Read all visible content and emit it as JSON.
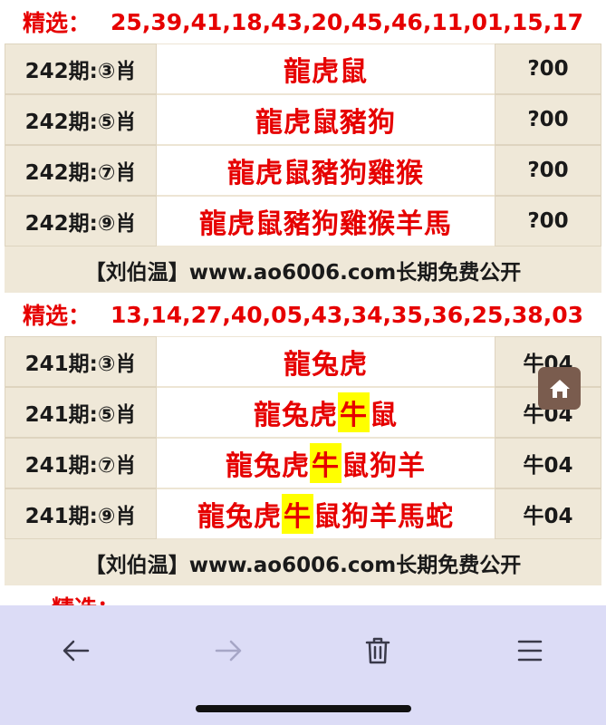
{
  "section1": {
    "pick_label": "精选：",
    "pick_numbers": "25,39,41,18,43,20,45,46,11,01,15,17",
    "rows": [
      {
        "period": "242期:③肖",
        "before": "龍虎鼠",
        "highlight": "",
        "after": "",
        "result": "?00"
      },
      {
        "period": "242期:⑤肖",
        "before": "龍虎鼠豬狗",
        "highlight": "",
        "after": "",
        "result": "?00"
      },
      {
        "period": "242期:⑦肖",
        "before": "龍虎鼠豬狗雞猴",
        "highlight": "",
        "after": "",
        "result": "?00"
      },
      {
        "period": "242期:⑨肖",
        "before": "龍虎鼠豬狗雞猴羊馬",
        "highlight": "",
        "after": "",
        "result": "?00"
      }
    ],
    "promo": "【刘伯温】www.ao6006.com长期免费公开"
  },
  "section2": {
    "pick_label": "精选：",
    "pick_numbers": "13,14,27,40,05,43,34,35,36,25,38,03",
    "rows": [
      {
        "period": "241期:③肖",
        "before": "龍兔虎",
        "highlight": "",
        "after": "",
        "result": "牛04"
      },
      {
        "period": "241期:⑤肖",
        "before": "龍兔虎",
        "highlight": "牛",
        "after": "鼠",
        "result": "牛04"
      },
      {
        "period": "241期:⑦肖",
        "before": "龍兔虎",
        "highlight": "牛",
        "after": "鼠狗羊",
        "result": "牛04"
      },
      {
        "period": "241期:⑨肖",
        "before": "龍兔虎",
        "highlight": "牛",
        "after": "鼠狗羊馬蛇",
        "result": "牛04"
      }
    ],
    "promo": "【刘伯温】www.ao6006.com长期免费公开"
  },
  "section3": {
    "pick_label": "精选："
  },
  "floating": {
    "home_icon": "home-icon"
  },
  "toolbar": {
    "back_icon": "arrow-left-icon",
    "forward_icon": "arrow-right-icon",
    "trash_icon": "trash-icon",
    "menu_icon": "hamburger-menu-icon"
  },
  "colors": {
    "accent_red": "#e60000",
    "cell_beige": "#efe8d8",
    "highlight_yellow": "#ffff00",
    "toolbar_bg": "#dcdcf6",
    "home_button": "#7a5c4e"
  }
}
